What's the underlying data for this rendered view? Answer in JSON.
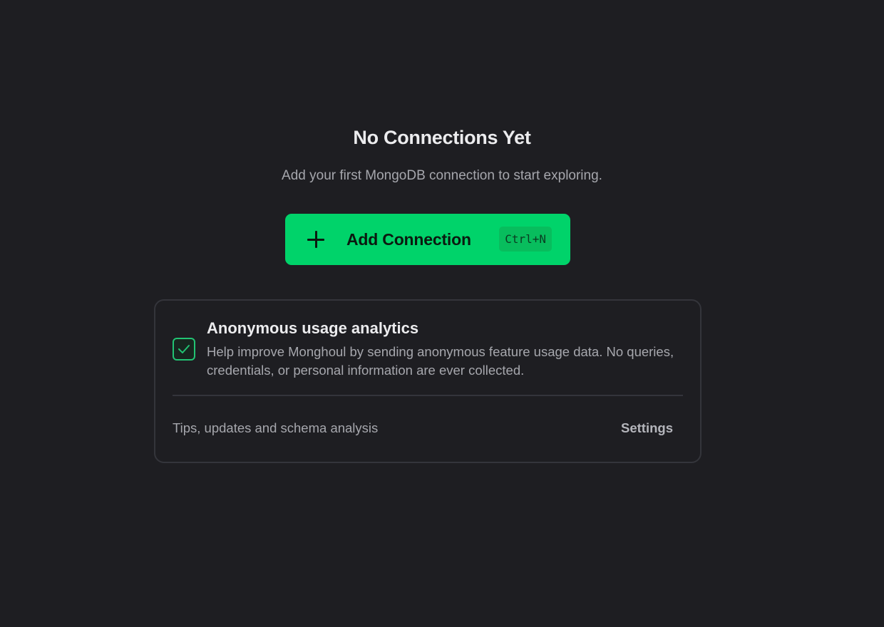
{
  "empty_state": {
    "title": "No Connections Yet",
    "subtitle": "Add your first MongoDB connection to start exploring."
  },
  "add_connection": {
    "icon": "plus-icon",
    "label": "Add Connection",
    "shortcut": "Ctrl+N",
    "color": "#00d36a"
  },
  "analytics_card": {
    "checkbox_checked": true,
    "checkbox_color": "#22c373",
    "title": "Anonymous usage analytics",
    "description": "Help improve Monghoul by sending anonymous feature usage data. No queries, credentials, or personal information are ever collected.",
    "footer_text": "Tips, updates and schema analysis",
    "settings_label": "Settings"
  },
  "colors": {
    "background": "#1e1e22",
    "accent": "#00d36a"
  }
}
